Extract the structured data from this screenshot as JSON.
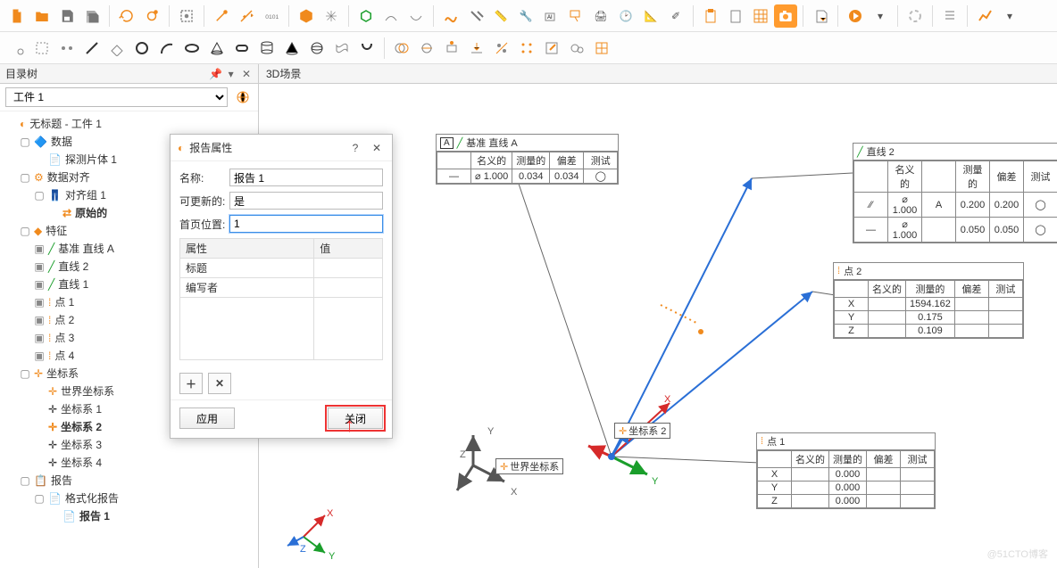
{
  "toolbar1": {
    "camera_active": true
  },
  "panels": {
    "tree_title": "目录树",
    "scene_title": "3D场景"
  },
  "combo": {
    "selected": "工件 1"
  },
  "tree": {
    "root": "无标题 - 工件 1",
    "data": "数据",
    "probe1": "探测片体 1",
    "align": "数据对齐",
    "alignGroup1": "对齐组 1",
    "original": "原始的",
    "features": "特征",
    "datumLineA": "基准 直线 A",
    "line2": "直线 2",
    "line1": "直线 1",
    "pt1": "点 1",
    "pt2": "点 2",
    "pt3": "点 3",
    "pt4": "点 4",
    "cs": "坐标系",
    "worldCS": "世界坐标系",
    "cs1": "坐标系 1",
    "cs2": "坐标系 2",
    "cs3": "坐标系 3",
    "cs4": "坐标系 4",
    "reports": "报告",
    "fmtReport": "格式化报告",
    "report1": "报告 1"
  },
  "dialog": {
    "title": "报告属性",
    "nameLabel": "名称:",
    "nameValue": "报告 1",
    "updatableLabel": "可更新的:",
    "updatableValue": "是",
    "firstPageLabel": "首页位置:",
    "firstPageValue": "1",
    "colProp": "属性",
    "colVal": "值",
    "rowTitle": "标题",
    "rowAuthor": "编写者",
    "apply": "应用",
    "close": "关闭"
  },
  "calloutA": {
    "title": "基准 直线 A",
    "letter": "A",
    "hdrNom": "名义的",
    "hdrMeas": "测量的",
    "hdrDev": "偏差",
    "hdrTest": "测试",
    "nom": "1.000",
    "meas": "0.034",
    "dev": "0.034"
  },
  "calloutL2": {
    "title": "直线 2",
    "hdrNom": "名义的",
    "hdrMeas": "测量的",
    "hdrDev": "偏差",
    "hdrTest": "测试",
    "r1nom": "1.000",
    "r1ref": "A",
    "r1meas": "0.200",
    "r1dev": "0.200",
    "r2nom": "1.000",
    "r2meas": "0.050",
    "r2dev": "0.050"
  },
  "calloutP2": {
    "title": "点 2",
    "hdrNom": "名义的",
    "hdrMeas": "测量的",
    "hdrDev": "偏差",
    "hdrTest": "测试",
    "x": "X",
    "xmeas": "1594.162",
    "y": "Y",
    "ymeas": "0.175",
    "z": "Z",
    "zmeas": "0.109"
  },
  "calloutP1": {
    "title": "点 1",
    "hdrNom": "名义的",
    "hdrMeas": "测量的",
    "hdrDev": "偏差",
    "hdrTest": "测试",
    "x": "X",
    "xmeas": "0.000",
    "y": "Y",
    "ymeas": "0.000",
    "z": "Z",
    "zmeas": "0.000"
  },
  "scene": {
    "worldCS": "世界坐标系",
    "cs2": "坐标系 2",
    "X": "X",
    "Y": "Y",
    "Z": "Z"
  },
  "watermark": "@51CTO博客"
}
